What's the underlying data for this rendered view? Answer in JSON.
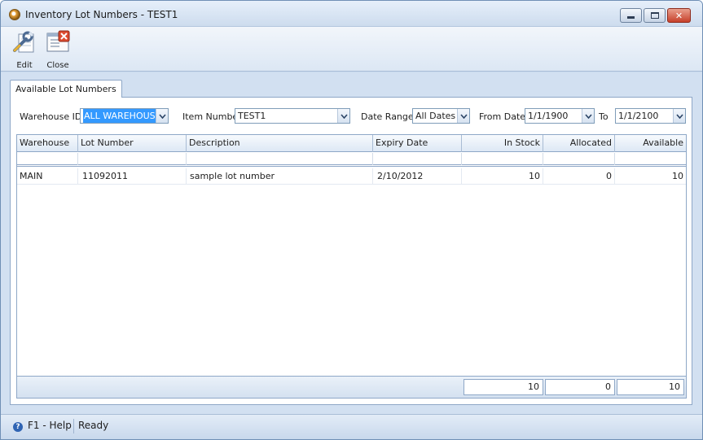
{
  "window": {
    "title": "Inventory Lot Numbers - TEST1",
    "min_glyph": "",
    "close_glyph": "✕"
  },
  "toolbar": {
    "edit_label": "Edit",
    "close_label": "Close"
  },
  "tab": {
    "label": "Available Lot Numbers"
  },
  "filters": {
    "warehouse_label": "Warehouse ID",
    "warehouse_value": "ALL WAREHOUSES",
    "item_label": "Item Number",
    "item_value": "TEST1",
    "range_label": "Date Range",
    "range_value": "All Dates",
    "from_label": "From Date",
    "from_value": "1/1/1900",
    "to_label": "To",
    "to_value": "1/1/2100"
  },
  "grid": {
    "columns": [
      "Warehouse",
      "Lot Number",
      "Description",
      "Expiry Date",
      "In Stock",
      "Allocated",
      "Available"
    ],
    "rows": [
      [
        "MAIN",
        "11092011",
        "sample lot number",
        "2/10/2012",
        "10",
        "0",
        "10"
      ]
    ],
    "totals": {
      "in_stock": "10",
      "allocated": "0",
      "available": "10"
    }
  },
  "status": {
    "help": "F1 - Help",
    "ready": "Ready"
  },
  "icons": {
    "app": "app-icon",
    "edit": "edit-wrench-icon",
    "close": "close-form-icon",
    "help": "help-icon",
    "dropdown": "chevron-down-icon"
  },
  "colors": {
    "selection": "#3399ff",
    "frame": "#c9daee",
    "border": "#8ea7c7"
  }
}
